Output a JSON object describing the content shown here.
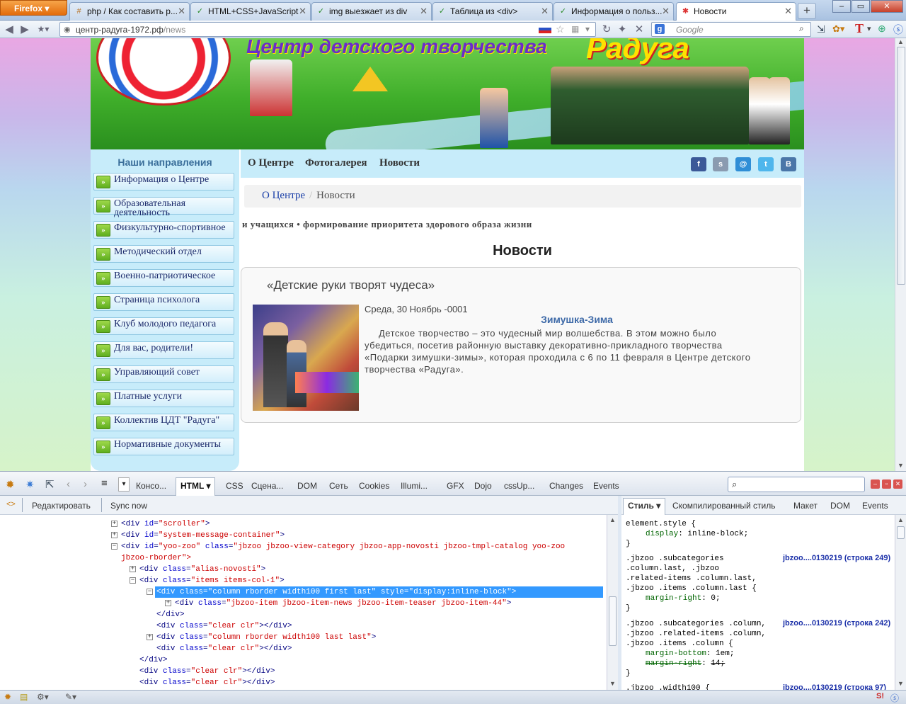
{
  "browser": {
    "menu_label": "Firefox",
    "tabs": [
      {
        "label": "php / Как составить р..."
      },
      {
        "label": "HTML+CSS+JavaScript"
      },
      {
        "label": "img выезжает из div"
      },
      {
        "label": "Таблица из <div>"
      },
      {
        "label": "Информация о польз..."
      },
      {
        "label": "Новости"
      }
    ],
    "url_main": "центр-радуга-1972.рф",
    "url_path": "/news",
    "search_placeholder": "Google"
  },
  "banner": {
    "title": "Центр детского творчества",
    "name": "Радуга"
  },
  "sidebar": {
    "title": "Наши направления",
    "items": [
      {
        "label": "Информация о Центре"
      },
      {
        "label": "Образовательная деятельность"
      },
      {
        "label": "Физкультурно-спортивное"
      },
      {
        "label": "Методический отдел"
      },
      {
        "label": "Военно-патриотическое"
      },
      {
        "label": "Страница психолога"
      },
      {
        "label": "Клуб молодого педагога"
      },
      {
        "label": "Для вас, родители!"
      },
      {
        "label": "Управляющий совет"
      },
      {
        "label": "Платные услуги"
      },
      {
        "label": "Коллектив ЦДТ \"Радуга\""
      },
      {
        "label": "Нормативные документы"
      }
    ]
  },
  "topnav": {
    "links": [
      {
        "label": "О Центре"
      },
      {
        "label": "Фотогалерея"
      },
      {
        "label": "Новости"
      }
    ],
    "social": [
      {
        "icon": "facebook-icon",
        "text": "f",
        "color": "#3b5998"
      },
      {
        "icon": "skype-icon",
        "text": "s",
        "color": "#8a9bb0"
      },
      {
        "icon": "mail-icon",
        "text": "@",
        "color": "#2f8ed6"
      },
      {
        "icon": "twitter-icon",
        "text": "t",
        "color": "#4fb6ec"
      },
      {
        "icon": "vk-icon",
        "text": "B",
        "color": "#4a76a8"
      }
    ]
  },
  "breadcrumb": {
    "home": "О Центре",
    "sep": "/",
    "current": "Новости"
  },
  "marquee": "и учащихся • формирование приоритета здорового образа жизни",
  "news": {
    "heading": "Новости",
    "item": {
      "title": "«Детские руки творят чудеса»",
      "date": "Среда, 30 Ноябрь -0001",
      "subtitle": "Зимушка-Зима",
      "body": "Детское творчество – это чудесный мир волшебства. В этом можно было убедиться, посетив районную выставку декоративно-прикладного творчества «Подарки зимушки-зимы», которая проходила с 6 по 11 февраля в Центре детского творчества «Радуга»."
    }
  },
  "firebug": {
    "tabs": [
      {
        "label": "Консо..."
      },
      {
        "label": "HTML ▾"
      },
      {
        "label": "CSS"
      },
      {
        "label": "Сцена..."
      },
      {
        "label": "DOM"
      },
      {
        "label": "Сеть"
      },
      {
        "label": "Cookies"
      },
      {
        "label": "Illumi..."
      },
      {
        "label": "GFX"
      },
      {
        "label": "Dojo"
      },
      {
        "label": "cssUp..."
      },
      {
        "label": "Changes"
      },
      {
        "label": "Events"
      }
    ],
    "edit_label": "Редактировать",
    "sync_label": "Sync now",
    "side_tabs": [
      {
        "label": "Стиль ▾"
      },
      {
        "label": "Скомпилированный стиль"
      },
      {
        "label": "Макет"
      },
      {
        "label": "DOM"
      },
      {
        "label": "Events"
      }
    ]
  },
  "html_tree": [
    {
      "pre": "<div ",
      "attr": "id",
      "val": "\"scroller\"",
      "post": ">",
      "toggle": "+"
    },
    {
      "pre": "<div ",
      "attr": "id",
      "val": "\"system-message-container\"",
      "post": ">",
      "toggle": "+"
    },
    {
      "pre": "<div ",
      "attr": "id",
      "val": "\"yoo-zoo\"",
      "post": "",
      "attr2": "class",
      "val2": "\"jbzoo jbzoo-view-category jbzoo-app-novosti jbzoo-tmpl-catalog yoo-zoo",
      "toggle": "-"
    },
    {
      "text": "jbzoo-rborder\">",
      "av": true
    },
    {
      "pre": "<div ",
      "attr": "class",
      "val": "\"alias-novosti\"",
      "post": ">",
      "toggle": "+"
    },
    {
      "pre": "<div ",
      "attr": "class",
      "val": "\"items items-col-1\"",
      "post": ">",
      "toggle": "-"
    },
    {
      "pre": "<div ",
      "attr": "class",
      "val": "\"column rborder width100 first last\"",
      "post": "",
      "attr2": "style",
      "val2": "\"display:inline-block\"",
      "post2": ">",
      "toggle": "-",
      "selected": true
    },
    {
      "pre": "<div ",
      "attr": "class",
      "val": "\"jbzoo-item jbzoo-item-news jbzoo-item-teaser jbzoo-item-44\"",
      "post": ">",
      "toggle": "+"
    },
    {
      "text": "</div>"
    },
    {
      "pre": "<div ",
      "attr": "class",
      "val": "\"clear clr\"",
      "post": "></div>"
    },
    {
      "pre": "<div ",
      "attr": "class",
      "val": "\"column rborder width100 last last\"",
      "post": ">",
      "toggle": "+"
    },
    {
      "pre": "<div ",
      "attr": "class",
      "val": "\"clear clr\"",
      "post": "></div>"
    },
    {
      "text": "</div>"
    },
    {
      "pre": "<div ",
      "attr": "class",
      "val": "\"clear clr\"",
      "post": "></div>"
    },
    {
      "pre": "<div ",
      "attr": "class",
      "val": "\"clear clr\"",
      "post": "></div>"
    }
  ],
  "css_rules": [
    {
      "text": "element.style {"
    },
    {
      "prop": "display",
      "value": "inline-block;"
    },
    {
      "text": "}"
    },
    {
      "text": ".jbzoo .subcategories",
      "src": "jbzoo....0130219 (строка 249)"
    },
    {
      "text": ".column.last, .jbzoo"
    },
    {
      "text": ".related-items .column.last,"
    },
    {
      "text": ".jbzoo .items .column.last {"
    },
    {
      "prop": "margin-right",
      "value": "0;"
    },
    {
      "text": "}"
    },
    {
      "text": ".jbzoo .subcategories .column,",
      "src": "jbzoo....0130219 (строка 242)"
    },
    {
      "text": ".jbzoo .related-items .column,"
    },
    {
      "text": ".jbzoo .items .column {"
    },
    {
      "prop": "margin-bottom",
      "value": "1em;"
    },
    {
      "prop": "margin-right",
      "value": "14;",
      "strike": true
    },
    {
      "text": "}"
    },
    {
      "text": ".jbzoo .width100 {",
      "src": "jbzoo....0130219 (строка 97)"
    }
  ]
}
